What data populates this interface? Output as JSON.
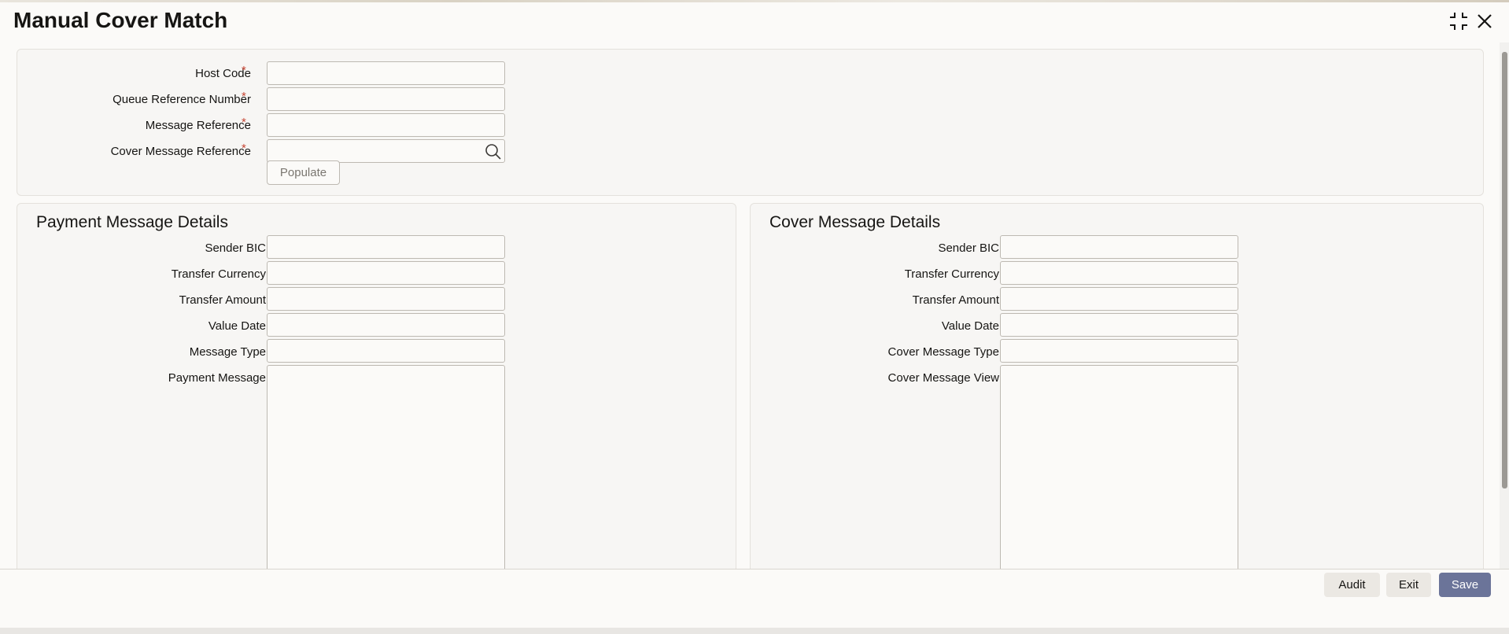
{
  "window": {
    "title": "Manual Cover Match"
  },
  "header_form": {
    "host_code_label": "Host Code",
    "queue_ref_label": "Queue Reference Number",
    "message_ref_label": "Message Reference",
    "cover_msg_ref_label": "Cover Message Reference",
    "required_mark": "*",
    "populate_label": "Populate"
  },
  "payment": {
    "title": "Payment Message Details",
    "sender_bic_label": "Sender BIC",
    "transfer_currency_label": "Transfer Currency",
    "transfer_amount_label": "Transfer Amount",
    "value_date_label": "Value Date",
    "message_type_label": "Message Type",
    "payment_message_label": "Payment Message"
  },
  "cover": {
    "title": "Cover Message Details",
    "sender_bic_label": "Sender BIC",
    "transfer_currency_label": "Transfer Currency",
    "transfer_amount_label": "Transfer Amount",
    "value_date_label": "Value Date",
    "cover_message_type_label": "Cover Message Type",
    "cover_message_view_label": "Cover Message View"
  },
  "footer": {
    "audit_label": "Audit",
    "exit_label": "Exit",
    "save_label": "Save"
  },
  "colors": {
    "primary_button": "#6b7499",
    "required": "#c74634",
    "title_text": "#161513"
  },
  "icons": [
    "maximize-icon",
    "close-icon",
    "search-icon"
  ]
}
